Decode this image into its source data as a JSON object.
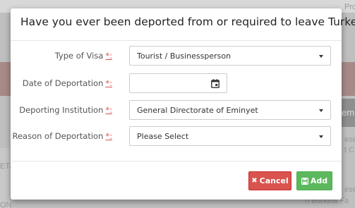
{
  "modal": {
    "title": "Have you ever been deported from or required to leave Turkey?"
  },
  "form": {
    "required_marker": "*:",
    "visa_type": {
      "label": "Type of Visa",
      "value": "Tourist / Businessperson"
    },
    "deportation_date": {
      "label": "Date of Deportation",
      "value": ""
    },
    "deporting_institution": {
      "label": "Deporting Institution",
      "value": "General Directorate of Eminyet"
    },
    "deportation_reason": {
      "label": "Reason of Deportation",
      "value": "Please Select"
    }
  },
  "footer": {
    "cancel_label": "Cancel",
    "add_label": "Add"
  },
  "background": {
    "top_right_text": "Pro",
    "right_text_1": "em",
    "right_text_2": "ese",
    "right_text_3": "t C",
    "right_text_4": "ese",
    "right_text_5": "n Burkina Fa",
    "left_text_1": "ETA",
    "left_text_2": "ON"
  },
  "colors": {
    "cancel": "#d9534f",
    "add": "#5cb85c",
    "required": "#d9534f"
  }
}
